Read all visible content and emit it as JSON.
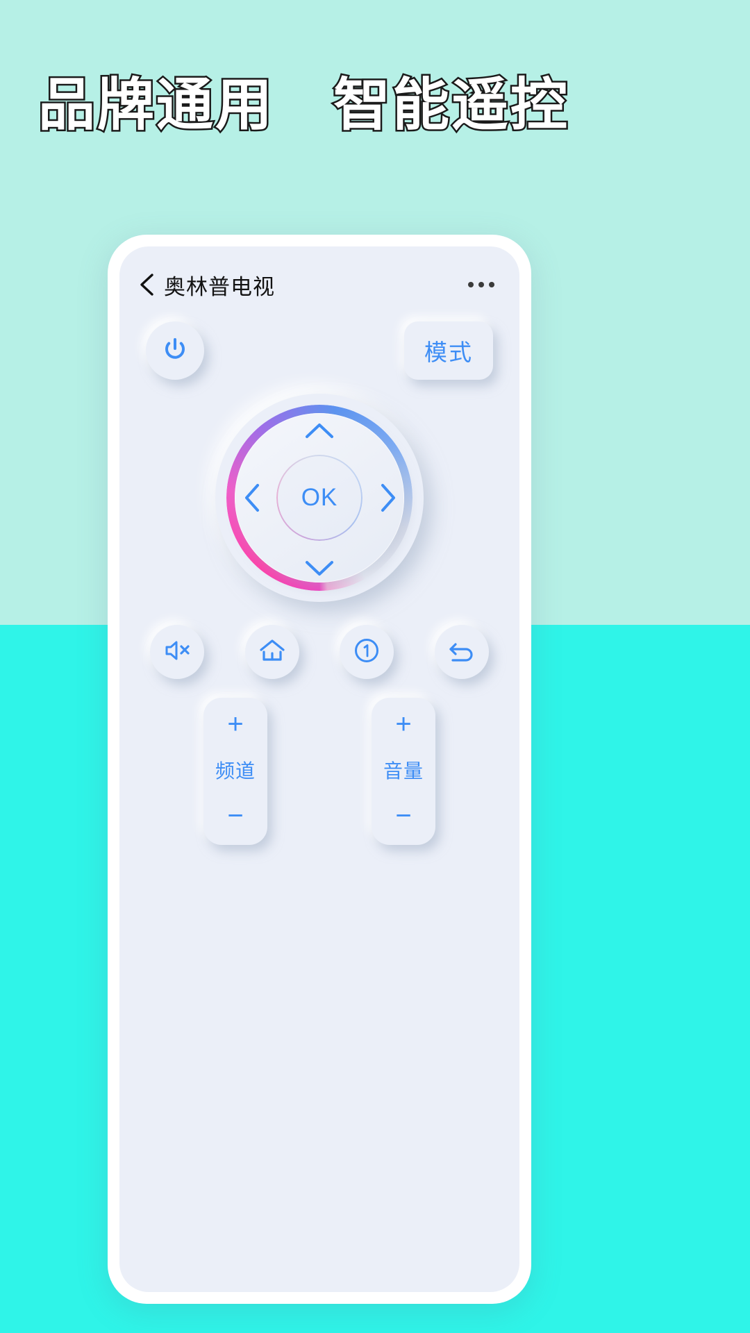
{
  "headline": "品牌通用　智能遥控",
  "colors": {
    "bg_top": "#b6f0e6",
    "bg_bottom": "#2ff4e8",
    "screen": "#ebeff8",
    "accent_blue": "#3d8df5",
    "ring_pink": "#f23ec0",
    "ring_blue": "#5b93f0"
  },
  "phone": {
    "titlebar": {
      "back_icon": "chevron-left-icon",
      "title": "奥林普电视",
      "more_icon": "more-horizontal-icon"
    },
    "power": {
      "icon": "power-icon",
      "label": ""
    },
    "mode_button": {
      "label": "模式"
    },
    "dpad": {
      "up_icon": "chevron-up-icon",
      "down_icon": "chevron-down-icon",
      "left_icon": "chevron-left-icon",
      "right_icon": "chevron-right-icon",
      "ok_label": "OK"
    },
    "function_buttons": [
      {
        "name": "mute-button",
        "icon": "speaker-mute-icon"
      },
      {
        "name": "home-button",
        "icon": "home-icon"
      },
      {
        "name": "source-button",
        "icon": "circled-one-icon"
      },
      {
        "name": "back-button",
        "icon": "undo-arrow-icon"
      }
    ],
    "rockers": [
      {
        "name": "channel-rocker",
        "plus": "+",
        "label": "频道",
        "minus": "−"
      },
      {
        "name": "volume-rocker",
        "plus": "+",
        "label": "音量",
        "minus": "−"
      }
    ]
  }
}
